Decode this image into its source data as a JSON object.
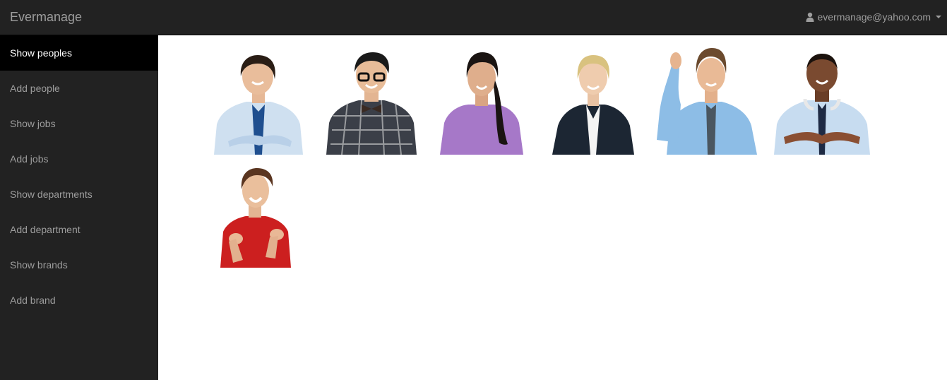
{
  "app": {
    "brand": "Evermanage",
    "user": {
      "email": "evermanage@yahoo.com",
      "icon": "user-icon"
    }
  },
  "sidebar": {
    "items": [
      {
        "label": "Show peoples",
        "active": true
      },
      {
        "label": "Add people",
        "active": false
      },
      {
        "label": "Show jobs",
        "active": false
      },
      {
        "label": "Add jobs",
        "active": false
      },
      {
        "label": "Show departments",
        "active": false
      },
      {
        "label": "Add department",
        "active": false
      },
      {
        "label": "Show brands",
        "active": false
      },
      {
        "label": "Add brand",
        "active": false
      }
    ]
  },
  "people": [
    {
      "name": "person-photo-1",
      "shirt": "#cfe0f0",
      "hair": "#2a1d15",
      "tie": "#1f4f8f"
    },
    {
      "name": "person-photo-2",
      "shirt": "#3b3f48",
      "hair": "#1a1a1a",
      "tie": "#3a2a22"
    },
    {
      "name": "person-photo-3",
      "shirt": "#a678c8",
      "hair": "#1a1412",
      "tie": ""
    },
    {
      "name": "person-photo-4",
      "shirt": "#1c2633",
      "hair": "#d9c27f",
      "tie": ""
    },
    {
      "name": "person-photo-5",
      "shirt": "#8dbde6",
      "hair": "#6b4a2e",
      "tie": "#4a5660"
    },
    {
      "name": "person-photo-6",
      "shirt": "#c7dcf0",
      "hair": "#1b120d",
      "tie": "#1e2a44"
    },
    {
      "name": "person-photo-7",
      "shirt": "#cc1f1f",
      "hair": "#5a3520",
      "tie": ""
    }
  ],
  "colors": {
    "navbar": "#222222",
    "sidebar": "#222222",
    "sidebar_active": "#000000",
    "text_muted": "#9d9d9d"
  }
}
